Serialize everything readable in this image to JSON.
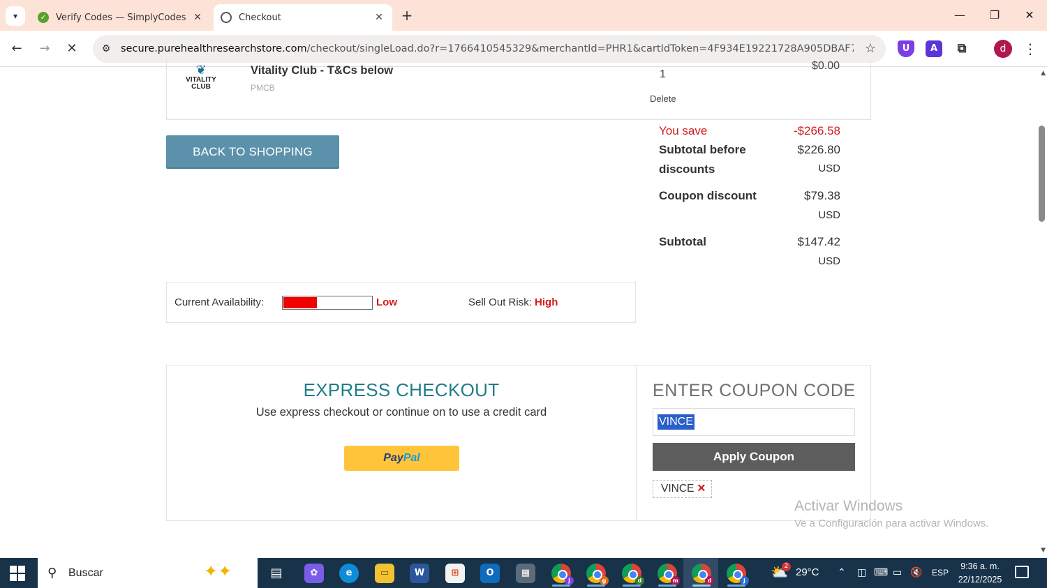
{
  "browser": {
    "tabs": [
      {
        "title": "Verify Codes — SimplyCodes",
        "icon": "simplycodes-icon",
        "active": false
      },
      {
        "title": "Checkout",
        "icon": "loading-globe-icon",
        "active": true
      }
    ],
    "url_host": "secure.purehealthresearchstore.com",
    "url_path": "/checkout/singleLoad.do?r=1766410545329&merchantId=PHR1&cartIdToken=4F934E19221728A905DBAF71C6907...",
    "profile_initial": "d"
  },
  "cart_item": {
    "logo_text": "VITALITY CLUB",
    "name": "Vitality Club - T&Cs below",
    "sku": "PMCB",
    "quantity": "1",
    "delete_label": "Delete",
    "price": "$0.00"
  },
  "back_button": "BACK TO SHOPPING",
  "summary": {
    "you_save_label": "You save",
    "you_save_value": "-$266.58",
    "subtotal_before_label_1": "Subtotal before",
    "subtotal_before_label_2": "discounts",
    "subtotal_before_value": "$226.80",
    "subtotal_before_currency": "USD",
    "coupon_discount_label": "Coupon discount",
    "coupon_discount_value": "$79.38",
    "coupon_discount_currency": "USD",
    "subtotal_label": "Subtotal",
    "subtotal_value": "$147.42",
    "subtotal_currency": "USD"
  },
  "availability": {
    "label": "Current Availability:",
    "level": "Low",
    "fill_percent": 38,
    "risk_label": "Sell Out Risk:",
    "risk_value": "High",
    "colors": {
      "fill": "#f20000",
      "text_red": "#d31a1a"
    }
  },
  "express": {
    "title": "EXPRESS CHECKOUT",
    "subtitle": "Use express checkout or continue on to use a credit card",
    "paypal_part1": "Pay",
    "paypal_part2": "Pal"
  },
  "coupon": {
    "title": "ENTER COUPON CODE",
    "input_value": "VINCE",
    "apply_label": "Apply Coupon",
    "applied_code": "VINCE",
    "remove_symbol": "✕"
  },
  "watermark": {
    "line1": "Activar Windows",
    "line2": "Ve a Configuración para activar Windows."
  },
  "taskbar": {
    "search_placeholder": "Buscar",
    "temperature": "29°C",
    "weather_badge": "2",
    "language": "ESP",
    "time": "9:36 a. m.",
    "date": "22/12/2025",
    "apps": [
      {
        "name": "task-view-icon",
        "color": "#18324a"
      },
      {
        "name": "copilot-icon",
        "color": "#7b5ce6"
      },
      {
        "name": "edge-icon",
        "color": "#0f8bd8"
      },
      {
        "name": "file-explorer-icon",
        "color": "#f2c232"
      },
      {
        "name": "word-icon",
        "color": "#2b579a"
      },
      {
        "name": "store-icon",
        "color": "#e8e8e8"
      },
      {
        "name": "outlook-icon",
        "color": "#0f6cbd"
      },
      {
        "name": "calculator-icon",
        "color": "#5c6b7a"
      }
    ],
    "chrome_profiles": [
      "j",
      "g",
      "d",
      "m",
      "d",
      "J"
    ],
    "chrome_badge_colors": [
      "#7b3fe4",
      "#e06c1a",
      "#3a7a2c",
      "#b0174f",
      "#b0174f",
      "#2e6bd1"
    ]
  }
}
